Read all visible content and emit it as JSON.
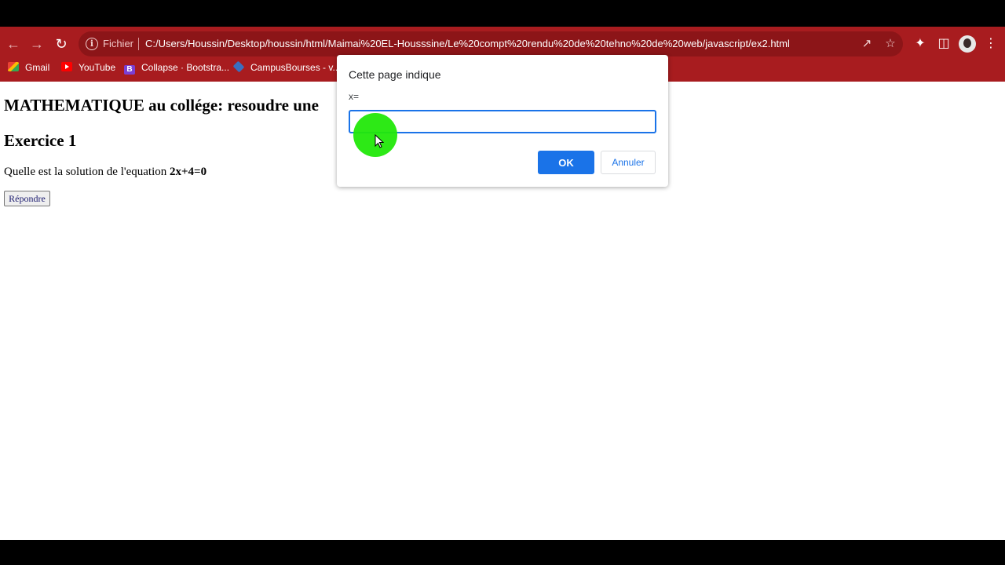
{
  "browser": {
    "scheme_label": "Fichier",
    "url": "C:/Users/Houssin/Desktop/houssin/html/Maimai%20EL-Housssine/Le%20compt%20rendu%20de%20tehno%20de%20web/javascript/ex2.html",
    "bookmarks": [
      {
        "label": "Gmail",
        "icon": "gmail-icon"
      },
      {
        "label": "YouTube",
        "icon": "youtube-icon"
      },
      {
        "label": "Collapse · Bootstra...",
        "icon": "bootstrap-icon"
      },
      {
        "label": "CampusBourses - v...",
        "icon": "campusbourses-icon"
      }
    ],
    "accent_color": "#a81c1f"
  },
  "page": {
    "heading": "MATHEMATIQUE au collége: resoudre une",
    "exercise_title": "Exercice 1",
    "question_text": "Quelle est la solution de l'equation ",
    "equation": "2x+4=0",
    "answer_button": "Répondre"
  },
  "dialog": {
    "title": "Cette page indique",
    "message": "x=",
    "input_value": "",
    "ok_label": "OK",
    "cancel_label": "Annuler",
    "button_color": "#1a73e8"
  }
}
